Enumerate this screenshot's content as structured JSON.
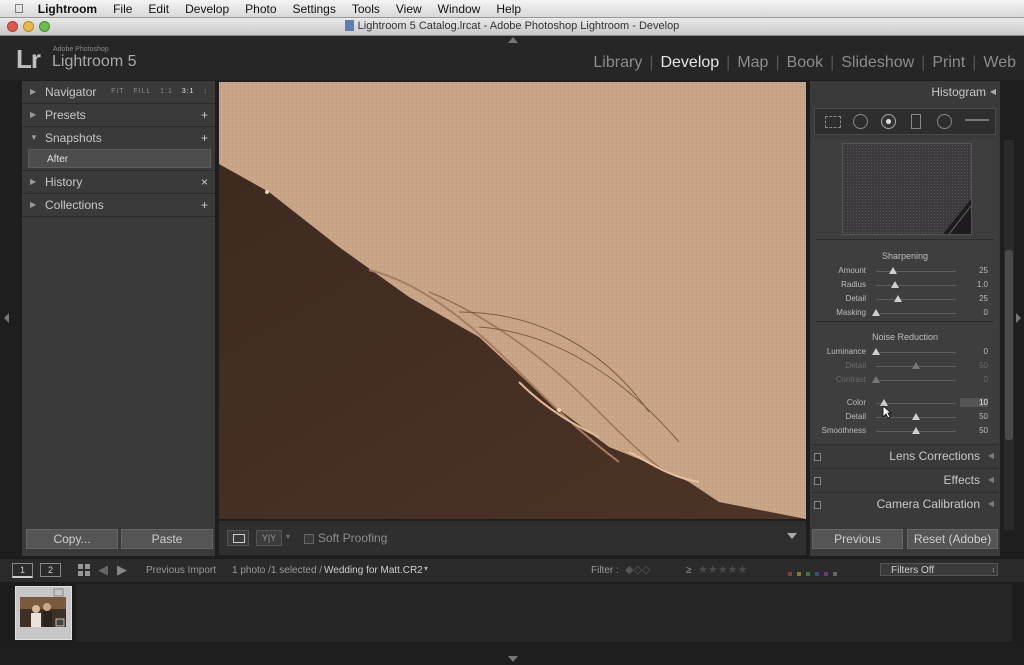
{
  "menubar": {
    "app": "Lightroom",
    "items": [
      "File",
      "Edit",
      "Develop",
      "Photo",
      "Settings",
      "Tools",
      "View",
      "Window",
      "Help"
    ]
  },
  "window": {
    "title": "Lightroom 5 Catalog.lrcat - Adobe Photoshop Lightroom - Develop"
  },
  "logo": {
    "mark": "Lr",
    "company": "Adobe Photoshop",
    "product": "Lightroom 5"
  },
  "modules": {
    "items": [
      "Library",
      "Develop",
      "Map",
      "Book",
      "Slideshow",
      "Print",
      "Web"
    ],
    "active": "Develop"
  },
  "left_panel": {
    "navigator": {
      "label": "Navigator",
      "options": [
        "FIT",
        "FILL",
        "1:1",
        "3:1"
      ]
    },
    "presets": {
      "label": "Presets",
      "action": "+"
    },
    "snapshots": {
      "label": "Snapshots",
      "action": "+",
      "items": [
        "After"
      ]
    },
    "history": {
      "label": "History",
      "action": "×"
    },
    "collections": {
      "label": "Collections",
      "action": "+"
    },
    "copy_button": "Copy...",
    "paste_button": "Paste"
  },
  "toolbar": {
    "compare_label": "Y|Y",
    "soft_proofing": "Soft Proofing"
  },
  "right_panel": {
    "histogram": {
      "label": "Histogram"
    },
    "sharpening": {
      "title": "Sharpening",
      "sliders": [
        {
          "label": "Amount",
          "value": "25",
          "level": 0.21
        },
        {
          "label": "Radius",
          "value": "1.0",
          "level": 0.24
        },
        {
          "label": "Detail",
          "value": "25",
          "level": 0.28
        },
        {
          "label": "Masking",
          "value": "0",
          "level": 0.0
        }
      ]
    },
    "noise_reduction": {
      "title": "Noise Reduction",
      "sliders": [
        {
          "label": "Luminance",
          "value": "0",
          "level": 0.0
        },
        {
          "label": "Detail",
          "value": "50",
          "level": 0.5,
          "disabled": true
        },
        {
          "label": "Contrast",
          "value": "0",
          "level": 0.0,
          "disabled": true
        },
        {
          "label": "Color",
          "value": "10",
          "level": 0.1
        },
        {
          "label": "Detail",
          "value": "50",
          "level": 0.5
        },
        {
          "label": "Smoothness",
          "value": "50",
          "level": 0.5
        }
      ]
    },
    "panels": [
      "Lens Corrections",
      "Effects",
      "Camera Calibration"
    ],
    "previous_button": "Previous",
    "reset_button": "Reset (Adobe)"
  },
  "filmstrip": {
    "screen1": "1",
    "screen2": "2",
    "source": "Previous Import",
    "count": "1 photo /1 selected /",
    "filename": "Wedding for Matt.CR2",
    "filter_label": "Filter :",
    "rating_op": "≥",
    "filters_off": "Filters Off"
  },
  "colors": {
    "background": "#1e1e1e",
    "panel": "#3a3a3a",
    "active_module": "#e6e6e6",
    "photo_bg": "#c8a486",
    "hair": "#4a3325"
  }
}
